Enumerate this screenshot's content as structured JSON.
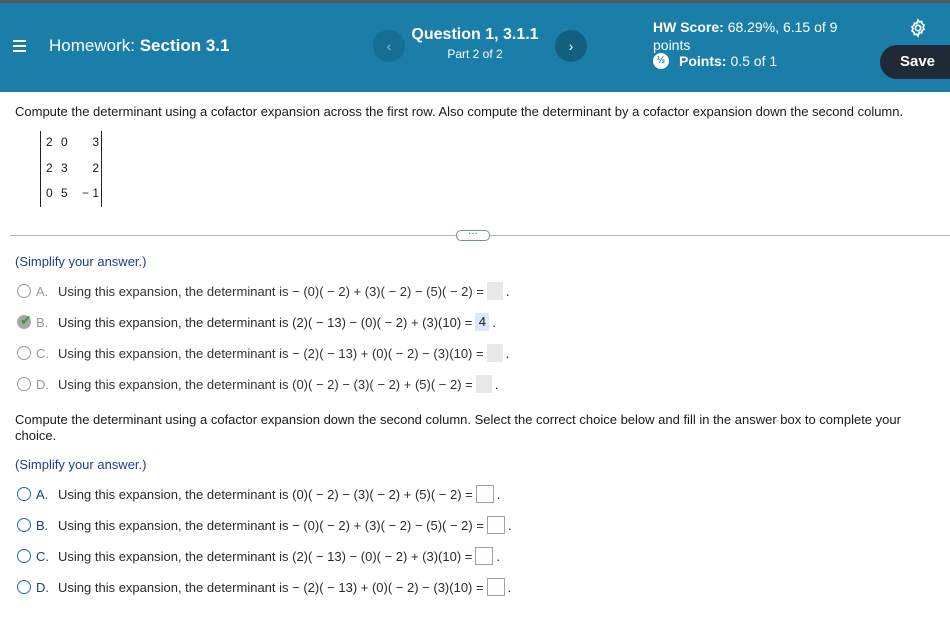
{
  "header": {
    "hw_label": "Homework:",
    "section": "Section 3.1",
    "question_title": "Question 1, 3.1.1",
    "question_part": "Part 2 of 2",
    "prev_glyph": "‹",
    "next_glyph": "›",
    "hw_score_label": "HW Score:",
    "hw_score_value": "68.29%, 6.15 of 9",
    "hw_score_unit": "points",
    "points_label": "Points:",
    "points_value": "0.5 of 1",
    "partial_glyph": "½",
    "save_label": "Save"
  },
  "colors": {
    "header_bg": "#1a7ea8",
    "save_bg": "#1f2a36",
    "link_blue": "#1d3f87",
    "check_green": "#2e9e3c"
  },
  "icons": [
    "hamburger-menu-icon",
    "gear-icon",
    "partial-credit-icon",
    "check-icon",
    "chevron-left-icon",
    "chevron-right-icon"
  ],
  "part1": {
    "prompt": "Compute the determinant using a cofactor expansion across the first row. Also compute the determinant by a cofactor expansion down the second column.",
    "matrix": [
      [
        "2",
        "0",
        "3"
      ],
      [
        "2",
        "3",
        "2"
      ],
      [
        "0",
        "5",
        "− 1"
      ]
    ],
    "more_label": "···",
    "simplify": "(Simplify your answer.)",
    "choices": [
      {
        "letter": "A.",
        "text": "Using this expansion, the determinant is  − (0)( − 2) + (3)( − 2) − (5)( − 2) =",
        "answer": ""
      },
      {
        "letter": "B.",
        "text": "Using this expansion, the determinant is (2)( − 13) − (0)( − 2) + (3)(10) =",
        "answer": "4"
      },
      {
        "letter": "C.",
        "text": "Using this expansion, the determinant is  − (2)( − 13) + (0)( − 2) − (3)(10) =",
        "answer": ""
      },
      {
        "letter": "D.",
        "text": "Using this expansion, the determinant is (0)( − 2) − (3)( − 2) + (5)( − 2) =",
        "answer": ""
      }
    ]
  },
  "part2": {
    "prompt": "Compute the determinant using a cofactor expansion down the second column. Select the correct choice below and fill in the answer box to complete your choice.",
    "simplify": "(Simplify your answer.)",
    "choices": [
      {
        "letter": "A.",
        "text": "Using this expansion, the determinant is (0)( − 2) − (3)( − 2) + (5)( − 2) ="
      },
      {
        "letter": "B.",
        "text": "Using this expansion, the determinant is  − (0)( − 2) + (3)( − 2) − (5)( − 2) ="
      },
      {
        "letter": "C.",
        "text": "Using this expansion, the determinant is (2)( − 13) − (0)( − 2) + (3)(10) ="
      },
      {
        "letter": "D.",
        "text": "Using this expansion, the determinant is  − (2)( − 13) + (0)( − 2) − (3)(10) ="
      }
    ]
  }
}
